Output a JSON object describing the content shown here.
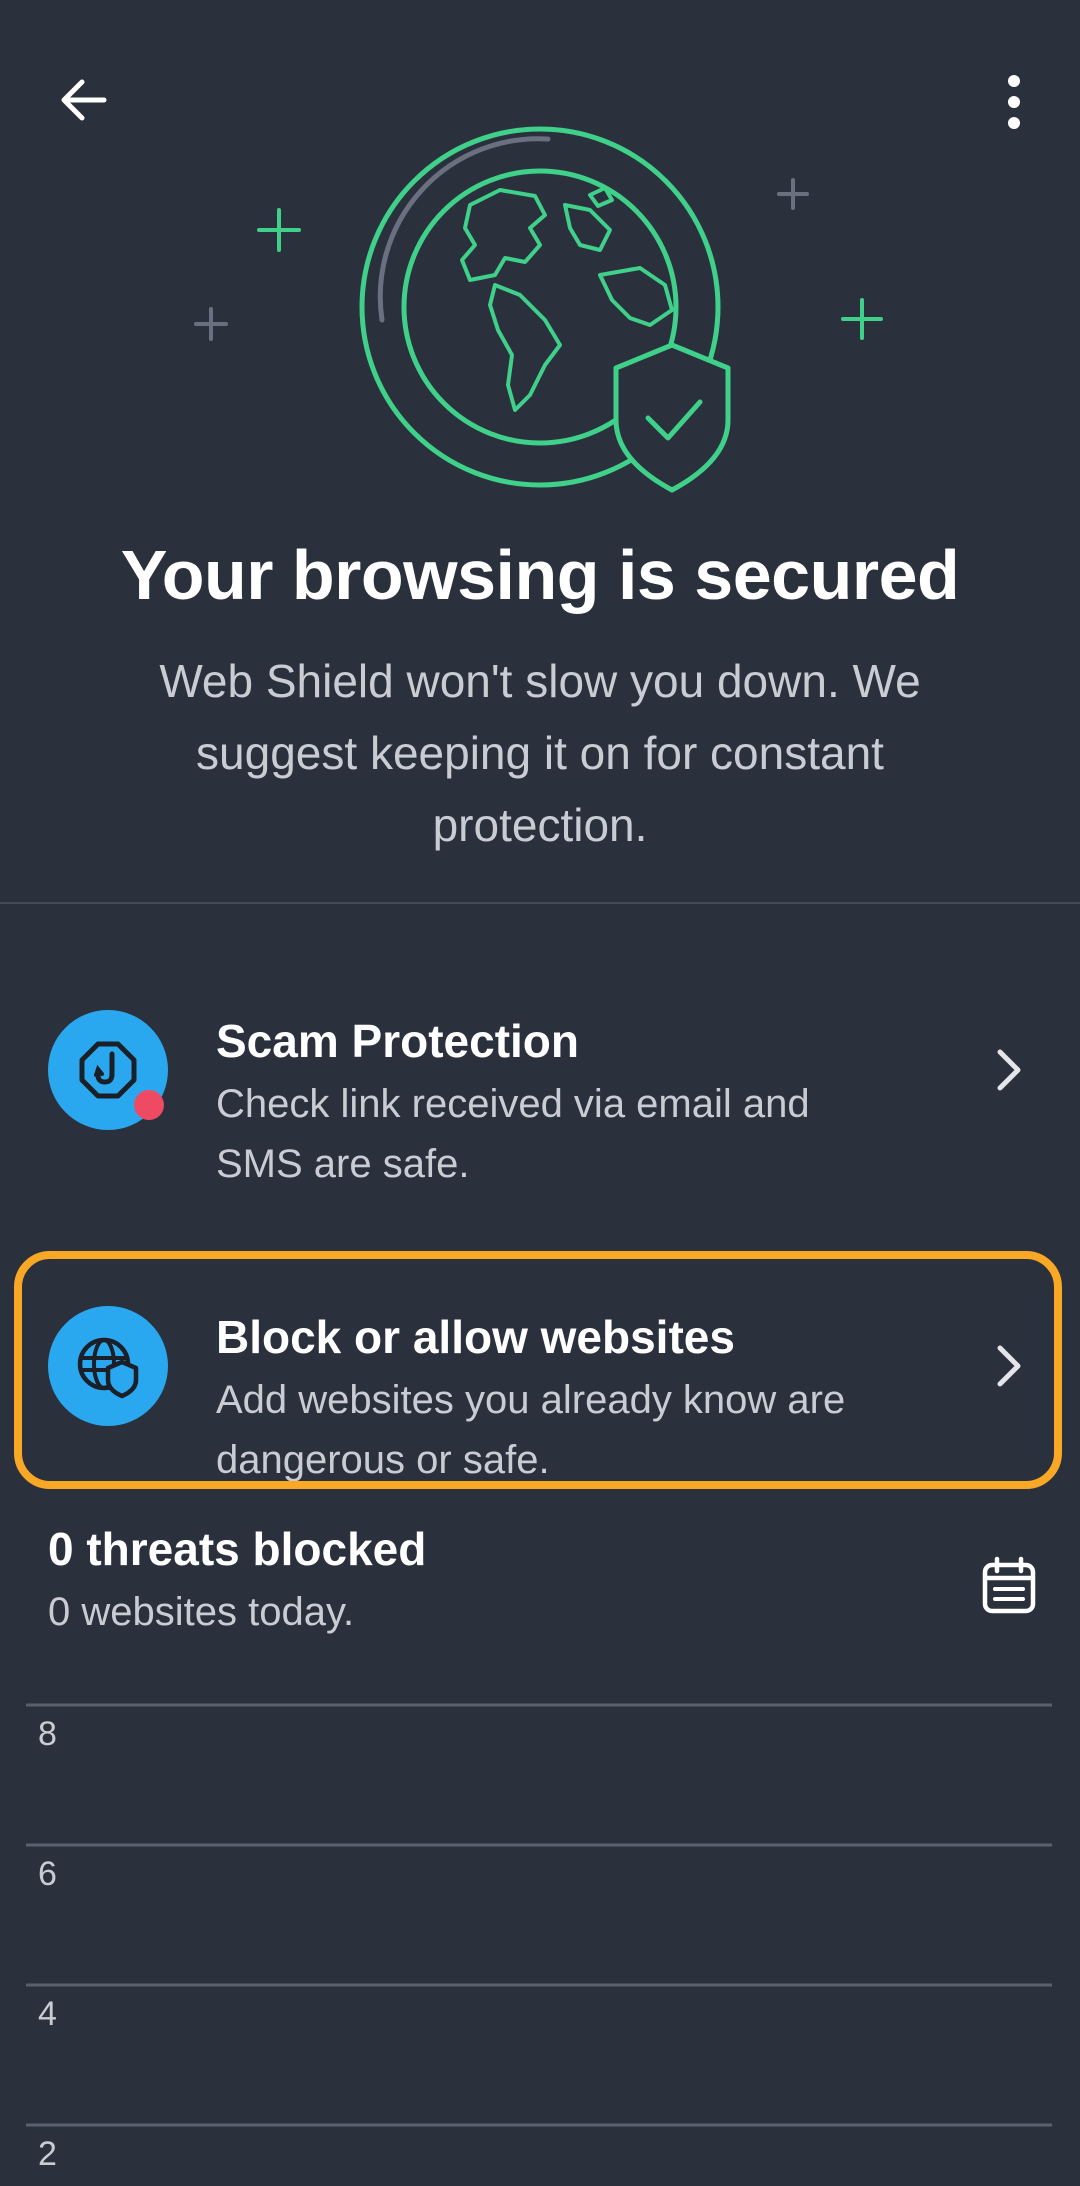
{
  "header": {
    "back_icon": "arrow-left-icon",
    "more_icon": "more-vertical-icon"
  },
  "hero": {
    "illustration": "globe-shield-icon",
    "accent": "#3fd08a"
  },
  "status": {
    "title": "Your browsing is secured",
    "description": "Web Shield won't slow you down. We suggest keeping it on for constant protection."
  },
  "features": [
    {
      "title": "Scam Protection",
      "description": "Check link received via email and SMS are safe.",
      "icon": "fishhook-icon",
      "badge_color": "#ef4a64"
    },
    {
      "title": "Block or allow websites",
      "description": "Add websites you already know are dangerous or safe.",
      "icon": "globe-shield-icon"
    }
  ],
  "threats": {
    "title": "0 threats blocked",
    "subtitle": "0 websites today.",
    "calendar_icon": "calendar-icon"
  },
  "chart_data": {
    "type": "bar",
    "y_ticks": [
      "8",
      "6",
      "4",
      "2"
    ],
    "ylim": [
      0,
      8
    ],
    "grid": true
  },
  "colors": {
    "background": "#2b303d",
    "icon_circle": "#2aa8ef",
    "highlight": "#f9a825"
  }
}
